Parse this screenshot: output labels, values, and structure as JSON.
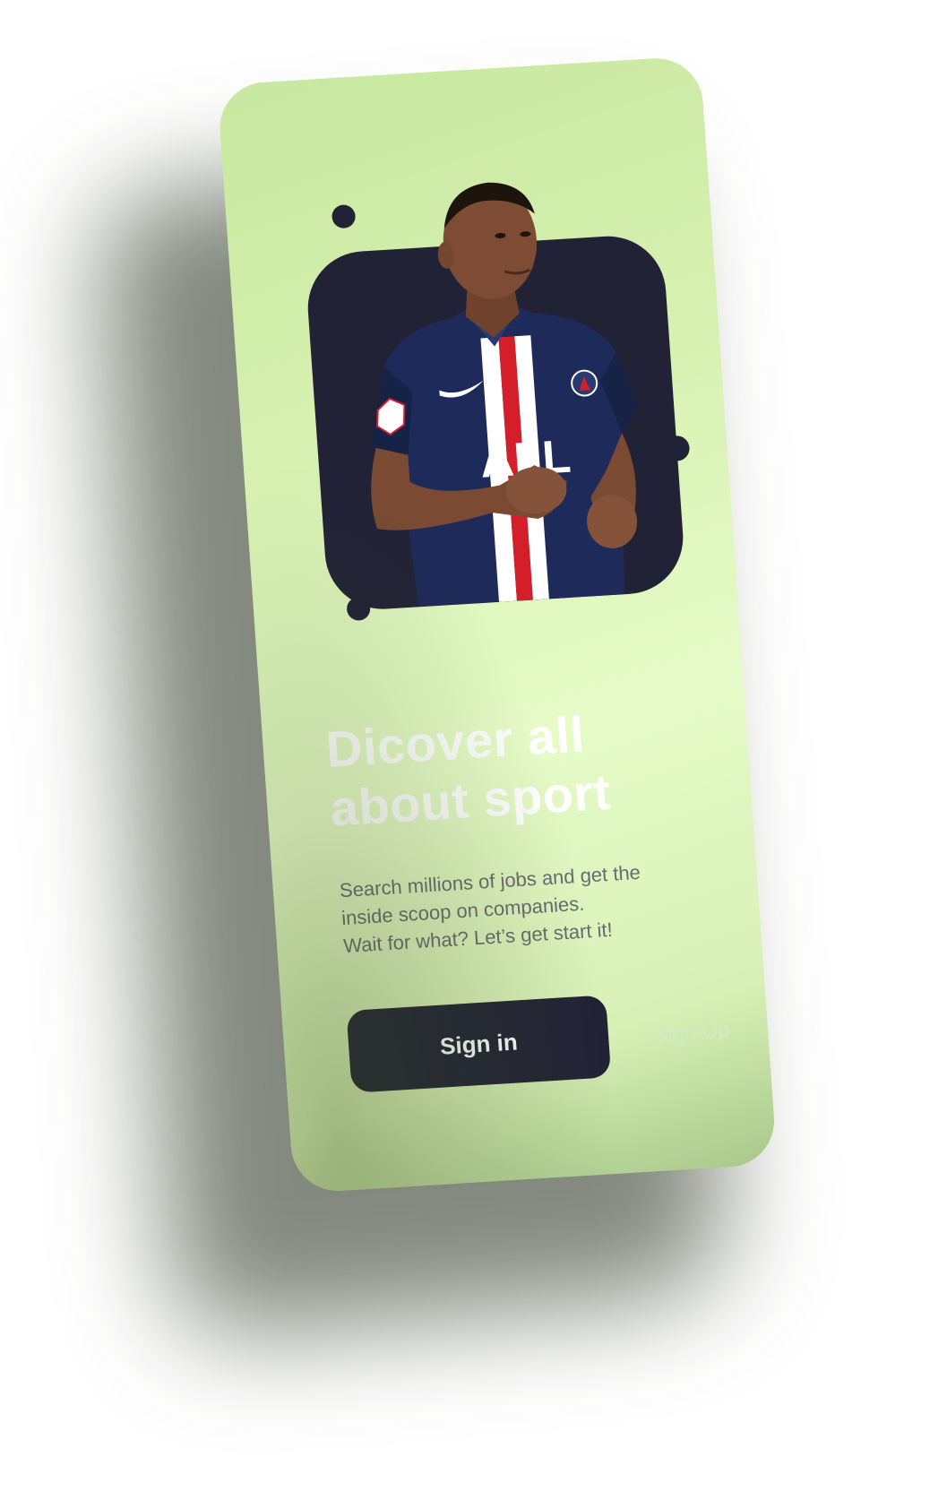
{
  "onboarding": {
    "headline": "Dicover all\nabout sport",
    "description": "Search millions of jobs and get the\ninside scoop on companies.\nWait for what? Let’s get start it!",
    "primary_button_label": "Sign in",
    "secondary_button_label": "Sign Up"
  },
  "hero_image": {
    "subject": "football player in navy striped jersey",
    "jersey_sponsor_text": "ALL"
  },
  "colors": {
    "background": "#e6fbc8",
    "accent_dark": "#222236",
    "headline": "#ffffff",
    "body_text": "#6a6a72",
    "secondary_link": "#d2ebc0",
    "jersey_navy": "#1d2a5a",
    "jersey_red": "#d41f2a"
  }
}
